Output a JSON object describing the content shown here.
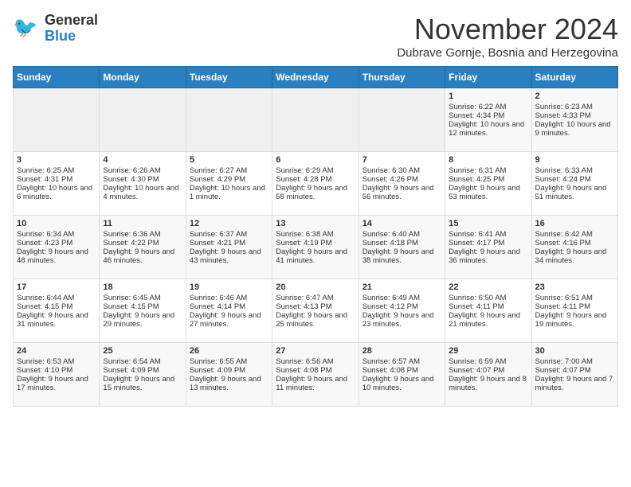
{
  "header": {
    "logo_general": "General",
    "logo_blue": "Blue",
    "month_title": "November 2024",
    "subtitle": "Dubrave Gornje, Bosnia and Herzegovina"
  },
  "days_of_week": [
    "Sunday",
    "Monday",
    "Tuesday",
    "Wednesday",
    "Thursday",
    "Friday",
    "Saturday"
  ],
  "weeks": [
    [
      {
        "day": "",
        "empty": true
      },
      {
        "day": "",
        "empty": true
      },
      {
        "day": "",
        "empty": true
      },
      {
        "day": "",
        "empty": true
      },
      {
        "day": "",
        "empty": true
      },
      {
        "day": "1",
        "sunrise": "Sunrise: 6:22 AM",
        "sunset": "Sunset: 4:34 PM",
        "daylight": "Daylight: 10 hours and 12 minutes."
      },
      {
        "day": "2",
        "sunrise": "Sunrise: 6:23 AM",
        "sunset": "Sunset: 4:33 PM",
        "daylight": "Daylight: 10 hours and 9 minutes."
      }
    ],
    [
      {
        "day": "3",
        "sunrise": "Sunrise: 6:25 AM",
        "sunset": "Sunset: 4:31 PM",
        "daylight": "Daylight: 10 hours and 6 minutes."
      },
      {
        "day": "4",
        "sunrise": "Sunrise: 6:26 AM",
        "sunset": "Sunset: 4:30 PM",
        "daylight": "Daylight: 10 hours and 4 minutes."
      },
      {
        "day": "5",
        "sunrise": "Sunrise: 6:27 AM",
        "sunset": "Sunset: 4:29 PM",
        "daylight": "Daylight: 10 hours and 1 minute."
      },
      {
        "day": "6",
        "sunrise": "Sunrise: 6:29 AM",
        "sunset": "Sunset: 4:28 PM",
        "daylight": "Daylight: 9 hours and 58 minutes."
      },
      {
        "day": "7",
        "sunrise": "Sunrise: 6:30 AM",
        "sunset": "Sunset: 4:26 PM",
        "daylight": "Daylight: 9 hours and 56 minutes."
      },
      {
        "day": "8",
        "sunrise": "Sunrise: 6:31 AM",
        "sunset": "Sunset: 4:25 PM",
        "daylight": "Daylight: 9 hours and 53 minutes."
      },
      {
        "day": "9",
        "sunrise": "Sunrise: 6:33 AM",
        "sunset": "Sunset: 4:24 PM",
        "daylight": "Daylight: 9 hours and 51 minutes."
      }
    ],
    [
      {
        "day": "10",
        "sunrise": "Sunrise: 6:34 AM",
        "sunset": "Sunset: 4:23 PM",
        "daylight": "Daylight: 9 hours and 48 minutes."
      },
      {
        "day": "11",
        "sunrise": "Sunrise: 6:36 AM",
        "sunset": "Sunset: 4:22 PM",
        "daylight": "Daylight: 9 hours and 46 minutes."
      },
      {
        "day": "12",
        "sunrise": "Sunrise: 6:37 AM",
        "sunset": "Sunset: 4:21 PM",
        "daylight": "Daylight: 9 hours and 43 minutes."
      },
      {
        "day": "13",
        "sunrise": "Sunrise: 6:38 AM",
        "sunset": "Sunset: 4:19 PM",
        "daylight": "Daylight: 9 hours and 41 minutes."
      },
      {
        "day": "14",
        "sunrise": "Sunrise: 6:40 AM",
        "sunset": "Sunset: 4:18 PM",
        "daylight": "Daylight: 9 hours and 38 minutes."
      },
      {
        "day": "15",
        "sunrise": "Sunrise: 6:41 AM",
        "sunset": "Sunset: 4:17 PM",
        "daylight": "Daylight: 9 hours and 36 minutes."
      },
      {
        "day": "16",
        "sunrise": "Sunrise: 6:42 AM",
        "sunset": "Sunset: 4:16 PM",
        "daylight": "Daylight: 9 hours and 34 minutes."
      }
    ],
    [
      {
        "day": "17",
        "sunrise": "Sunrise: 6:44 AM",
        "sunset": "Sunset: 4:15 PM",
        "daylight": "Daylight: 9 hours and 31 minutes."
      },
      {
        "day": "18",
        "sunrise": "Sunrise: 6:45 AM",
        "sunset": "Sunset: 4:15 PM",
        "daylight": "Daylight: 9 hours and 29 minutes."
      },
      {
        "day": "19",
        "sunrise": "Sunrise: 6:46 AM",
        "sunset": "Sunset: 4:14 PM",
        "daylight": "Daylight: 9 hours and 27 minutes."
      },
      {
        "day": "20",
        "sunrise": "Sunrise: 6:47 AM",
        "sunset": "Sunset: 4:13 PM",
        "daylight": "Daylight: 9 hours and 25 minutes."
      },
      {
        "day": "21",
        "sunrise": "Sunrise: 6:49 AM",
        "sunset": "Sunset: 4:12 PM",
        "daylight": "Daylight: 9 hours and 23 minutes."
      },
      {
        "day": "22",
        "sunrise": "Sunrise: 6:50 AM",
        "sunset": "Sunset: 4:11 PM",
        "daylight": "Daylight: 9 hours and 21 minutes."
      },
      {
        "day": "23",
        "sunrise": "Sunrise: 6:51 AM",
        "sunset": "Sunset: 4:11 PM",
        "daylight": "Daylight: 9 hours and 19 minutes."
      }
    ],
    [
      {
        "day": "24",
        "sunrise": "Sunrise: 6:53 AM",
        "sunset": "Sunset: 4:10 PM",
        "daylight": "Daylight: 9 hours and 17 minutes."
      },
      {
        "day": "25",
        "sunrise": "Sunrise: 6:54 AM",
        "sunset": "Sunset: 4:09 PM",
        "daylight": "Daylight: 9 hours and 15 minutes."
      },
      {
        "day": "26",
        "sunrise": "Sunrise: 6:55 AM",
        "sunset": "Sunset: 4:09 PM",
        "daylight": "Daylight: 9 hours and 13 minutes."
      },
      {
        "day": "27",
        "sunrise": "Sunrise: 6:56 AM",
        "sunset": "Sunset: 4:08 PM",
        "daylight": "Daylight: 9 hours and 11 minutes."
      },
      {
        "day": "28",
        "sunrise": "Sunrise: 6:57 AM",
        "sunset": "Sunset: 4:08 PM",
        "daylight": "Daylight: 9 hours and 10 minutes."
      },
      {
        "day": "29",
        "sunrise": "Sunrise: 6:59 AM",
        "sunset": "Sunset: 4:07 PM",
        "daylight": "Daylight: 9 hours and 8 minutes."
      },
      {
        "day": "30",
        "sunrise": "Sunrise: 7:00 AM",
        "sunset": "Sunset: 4:07 PM",
        "daylight": "Daylight: 9 hours and 7 minutes."
      }
    ]
  ]
}
